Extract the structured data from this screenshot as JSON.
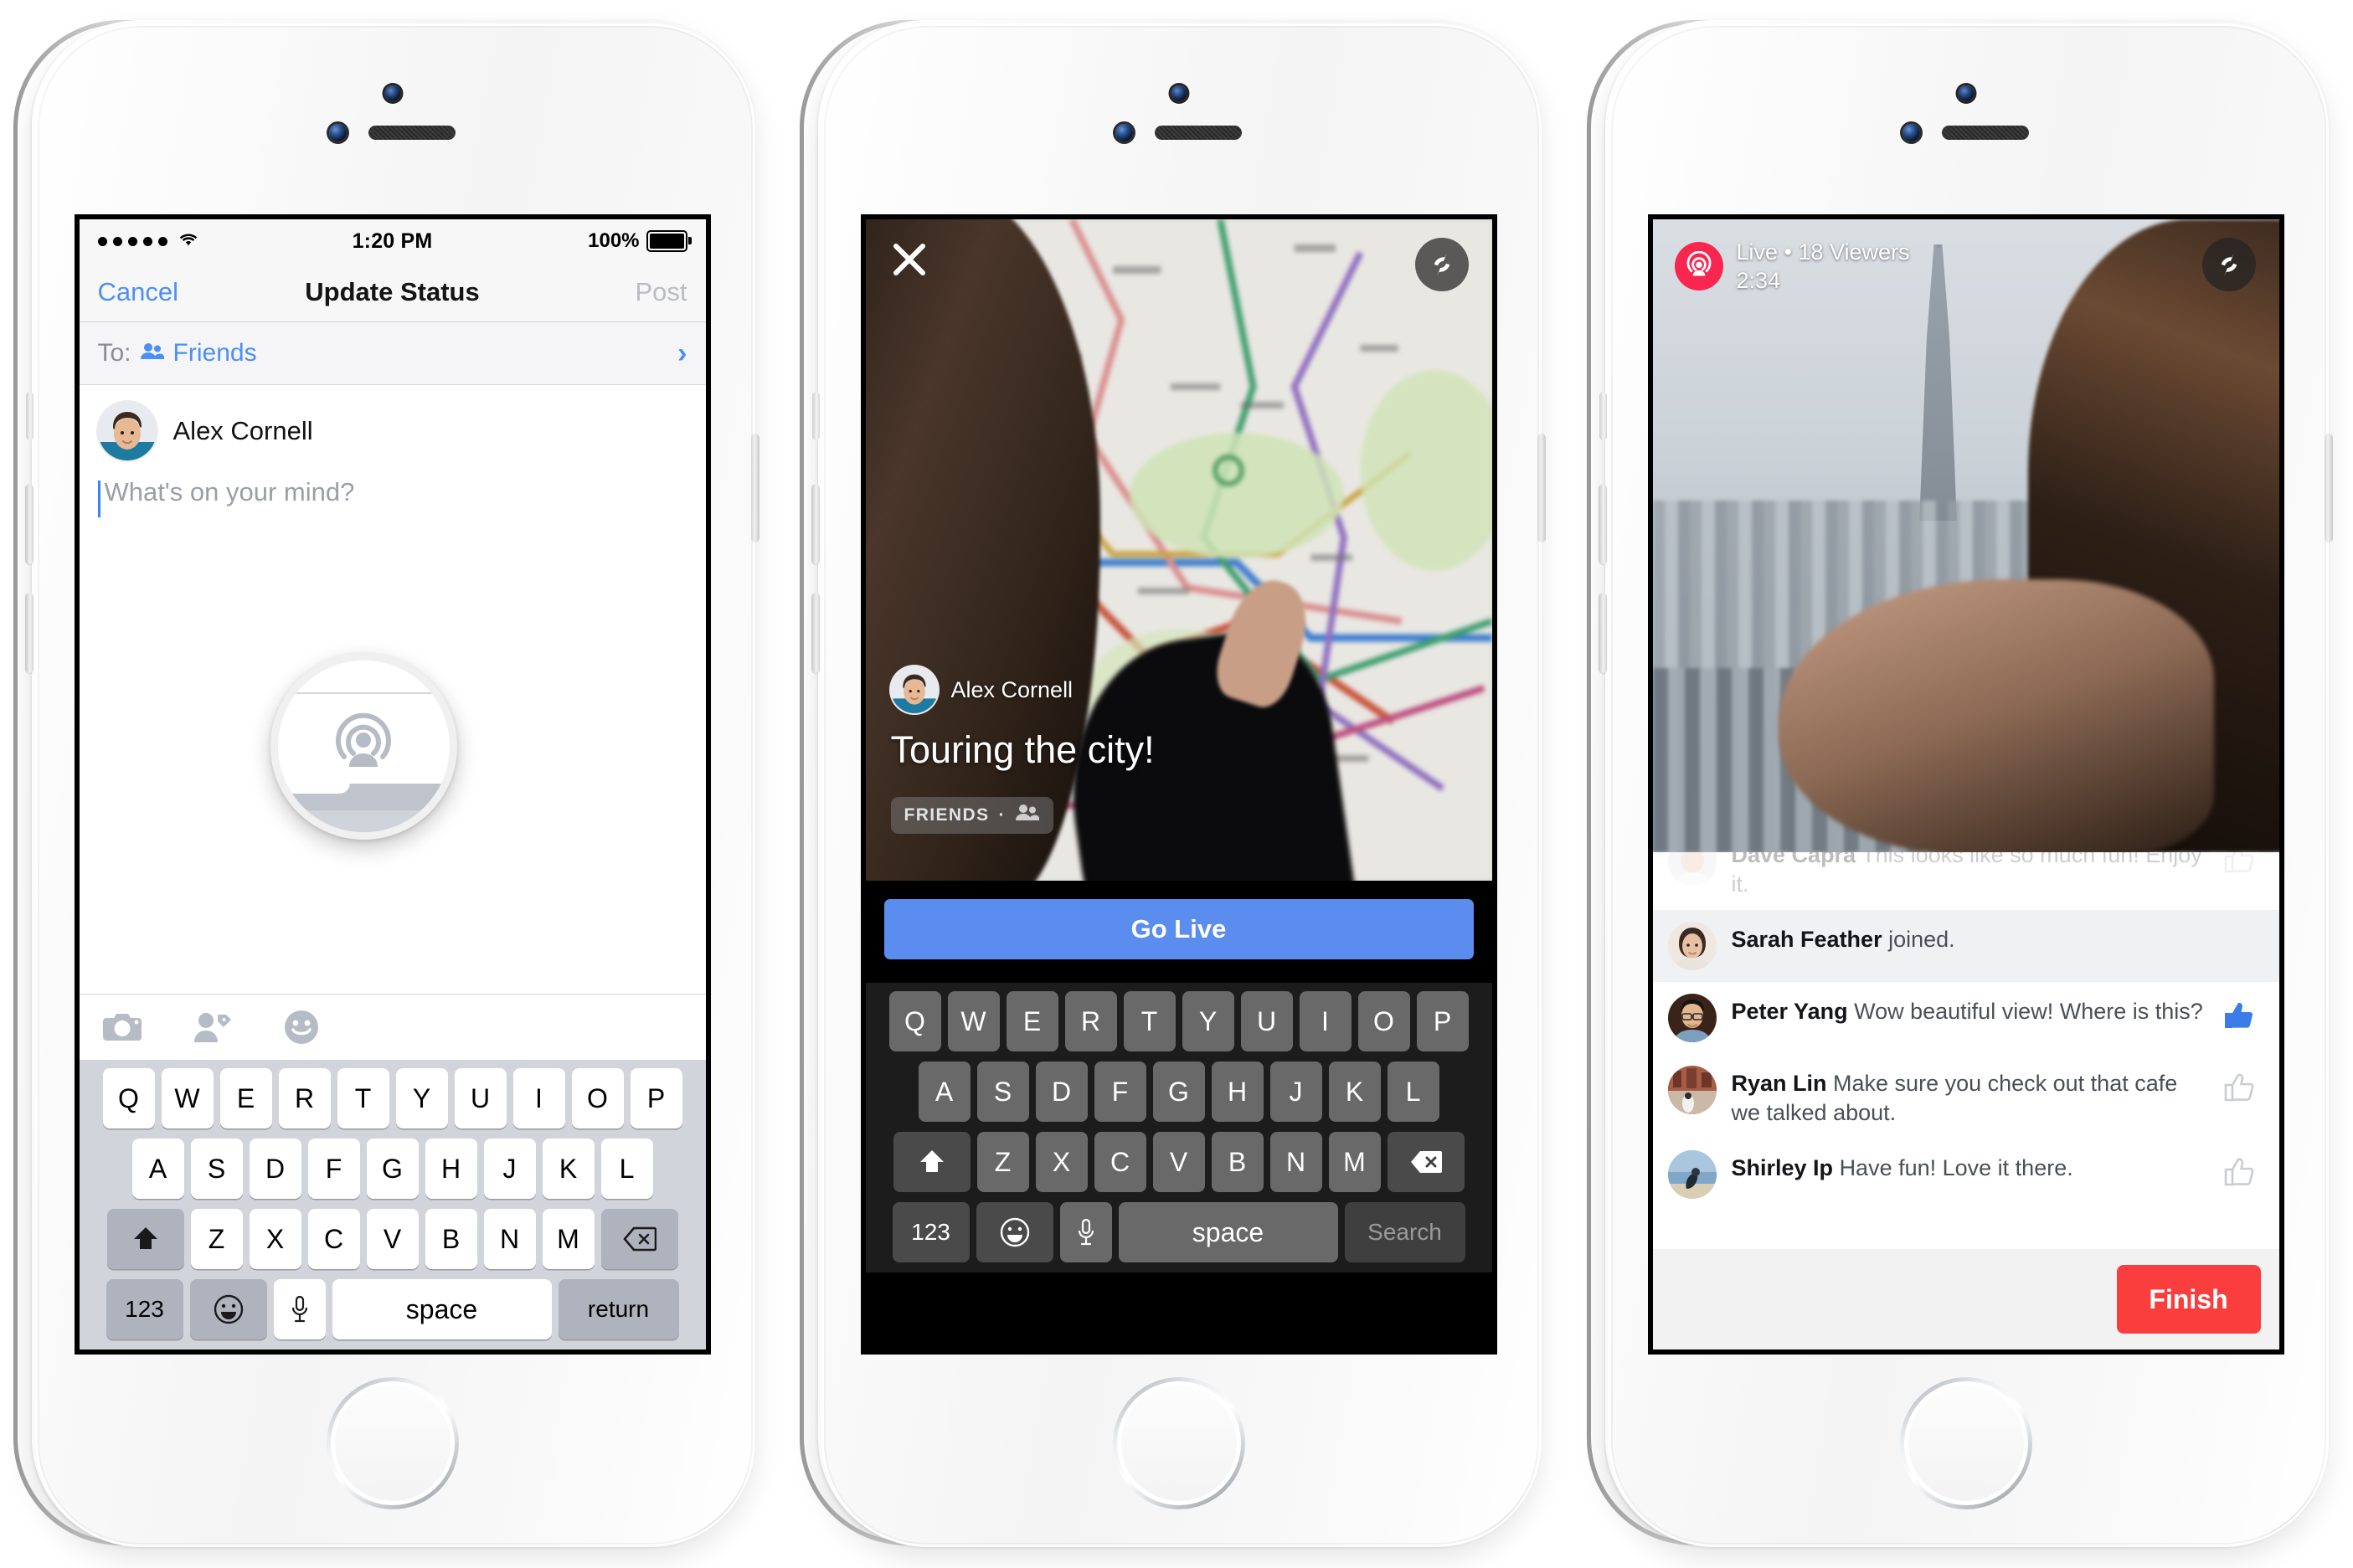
{
  "phone1": {
    "status_bar": {
      "time": "1:20 PM",
      "battery_percent": "100%",
      "signal_dots": 5
    },
    "nav": {
      "cancel": "Cancel",
      "title": "Update Status",
      "post": "Post"
    },
    "audience_row": {
      "label": "To:",
      "value": "Friends",
      "chevron": "›"
    },
    "author": {
      "name": "Alex Cornell"
    },
    "composer": {
      "placeholder": "What's on your mind?"
    },
    "toolbar": {
      "icons": [
        "camera-icon",
        "tag-person-icon",
        "smiley-icon",
        "live-broadcast-icon"
      ]
    },
    "magnifier": {
      "icon": "live-broadcast-icon"
    },
    "keyboard": {
      "row1": [
        "Q",
        "W",
        "E",
        "R",
        "T",
        "Y",
        "U",
        "I",
        "O",
        "P"
      ],
      "row2": [
        "A",
        "S",
        "D",
        "F",
        "G",
        "H",
        "J",
        "K",
        "L"
      ],
      "row3": [
        "Z",
        "X",
        "C",
        "V",
        "B",
        "N",
        "M"
      ],
      "shift": "shift-icon",
      "backspace": "backspace-icon",
      "numbers": "123",
      "emoji": "emoji-icon",
      "mic": "microphone-icon",
      "space": "space",
      "return": "return"
    }
  },
  "phone2": {
    "close": "close-icon",
    "flip_camera": "flip-camera-icon",
    "author": {
      "name": "Alex Cornell"
    },
    "title": "Touring the city!",
    "privacy": {
      "label": "FRIENDS",
      "separator": "·",
      "icon": "friends-icon"
    },
    "go_live": "Go Live",
    "keyboard": {
      "row1": [
        "Q",
        "W",
        "E",
        "R",
        "T",
        "Y",
        "U",
        "I",
        "O",
        "P"
      ],
      "row2": [
        "A",
        "S",
        "D",
        "F",
        "G",
        "H",
        "J",
        "K",
        "L"
      ],
      "row3": [
        "Z",
        "X",
        "C",
        "V",
        "B",
        "N",
        "M"
      ],
      "shift": "shift-icon",
      "backspace": "backspace-icon",
      "numbers": "123",
      "emoji": "emoji-icon",
      "mic": "microphone-icon",
      "space": "space",
      "return": "Search"
    }
  },
  "phone3": {
    "live": {
      "icon": "live-broadcast-icon",
      "status": "Live • 18 Viewers",
      "elapsed": "2:34"
    },
    "flip_camera": "flip-camera-icon",
    "comments": [
      {
        "name": "Dave Capra",
        "text": "This looks like so much fun! Enjoy it.",
        "liked": false,
        "faded": true,
        "joined": false
      },
      {
        "name": "Sarah Feather",
        "text": "joined.",
        "liked": false,
        "faded": false,
        "joined": true
      },
      {
        "name": "Peter Yang",
        "text": "Wow beautiful view! Where is this?",
        "liked": true,
        "faded": false,
        "joined": false
      },
      {
        "name": "Ryan Lin",
        "text": "Make sure you check out that cafe we talked about.",
        "liked": false,
        "faded": false,
        "joined": false
      },
      {
        "name": "Shirley Ip",
        "text": "Have fun! Love it there.",
        "liked": false,
        "faded": false,
        "joined": false
      }
    ],
    "finish": "Finish"
  },
  "colors": {
    "link_blue": "#4a90f5",
    "go_live_blue": "#5b8def",
    "finish_red": "#fa3e3e",
    "live_red": "#f9264f",
    "like_blue": "#3b7ce8"
  }
}
